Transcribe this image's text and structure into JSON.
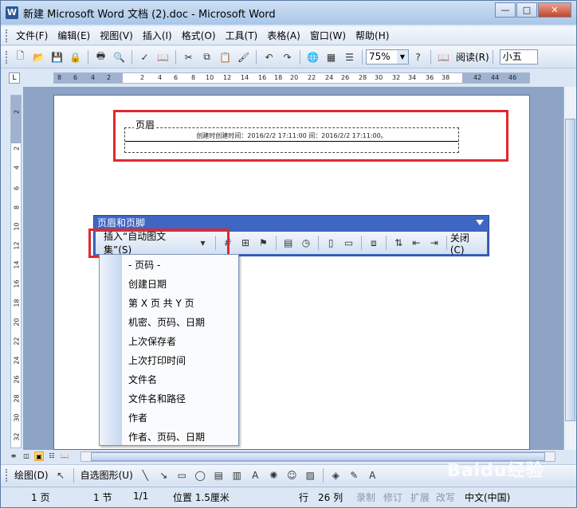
{
  "window": {
    "title": "新建 Microsoft Word 文档 (2).doc - Microsoft Word",
    "controls": {
      "minimize": "—",
      "maximize": "□",
      "close": "✕"
    }
  },
  "menubar": [
    "文件(F)",
    "编辑(E)",
    "视图(V)",
    "插入(I)",
    "格式(O)",
    "工具(T)",
    "表格(A)",
    "窗口(W)",
    "帮助(H)"
  ],
  "toolbar": {
    "zoom": "75%",
    "read_label": "阅读(R)",
    "font_size": "小五"
  },
  "ruler": {
    "h_ticks": [
      "8",
      "6",
      "4",
      "2",
      "2",
      "4",
      "6",
      "8",
      "10",
      "12",
      "14",
      "16",
      "18",
      "20",
      "22",
      "24",
      "26",
      "28",
      "30",
      "32",
      "34",
      "36",
      "38",
      "42",
      "44",
      "46"
    ],
    "v_ticks": [
      "2",
      "2",
      "4",
      "6",
      "8",
      "10",
      "12",
      "14",
      "16",
      "18",
      "20",
      "22",
      "24",
      "26",
      "28",
      "30",
      "32"
    ]
  },
  "document": {
    "header_label": "页眉",
    "header_text": "创建时创建时间：2016/2/2 17:11:00 间：2016/2/2 17:11:00。"
  },
  "header_footer_toolbar": {
    "title": "页眉和页脚",
    "insert_autotext": "插入“自动图文集”(S)",
    "close_label": "关闭(C)"
  },
  "autotext_menu": [
    "- 页码 -",
    "创建日期",
    "第 X 页 共 Y 页",
    "机密、页码、日期",
    "上次保存者",
    "上次打印时间",
    "文件名",
    "文件名和路径",
    "作者",
    "作者、页码、日期"
  ],
  "drawing_toolbar": {
    "draw_label": "绘图(D)",
    "autoshapes_label": "自选图形(U)"
  },
  "statusbar": {
    "page": "1 页",
    "section": "1 节",
    "page_of": "1/1",
    "position": "位置 1.5厘米",
    "line": "行",
    "column": "26 列",
    "rec": "录制",
    "trk": "修订",
    "ext": "扩展",
    "ovr": "改写",
    "language": "中文(中国)"
  },
  "watermark": "Baidu经验"
}
